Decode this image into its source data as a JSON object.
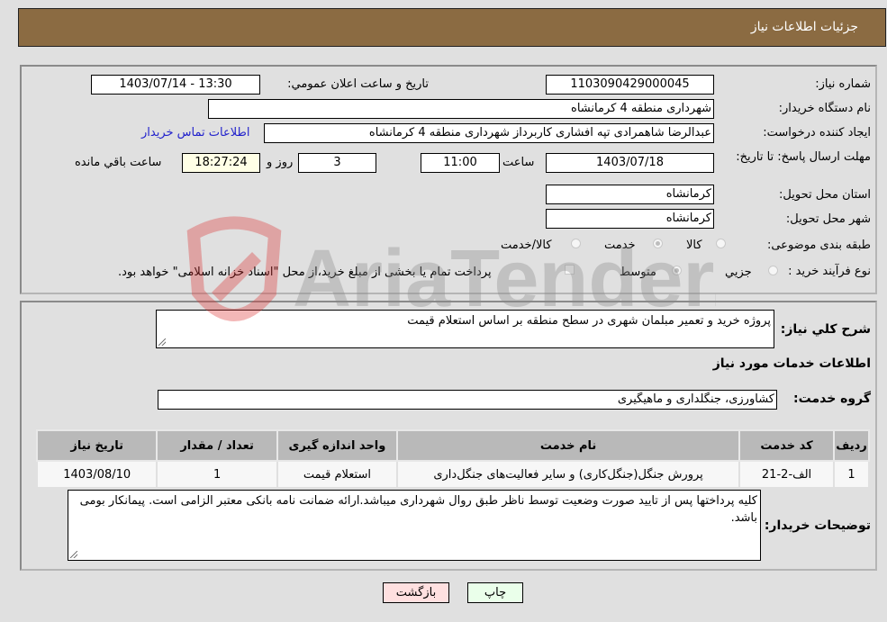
{
  "header": {
    "title": "جزئیات اطلاعات نیاز"
  },
  "form": {
    "need_number": {
      "label": "شماره نیاز:",
      "value": "1103090429000045"
    },
    "announce_datetime": {
      "label": "تاریخ و ساعت اعلان عمومي:",
      "value": "1403/07/14 - 13:30"
    },
    "buyer_org": {
      "label": "نام دستگاه خریدار:",
      "value": "شهرداری منطقه 4 کرمانشاه"
    },
    "requester": {
      "label": "ایجاد کننده درخواست:",
      "value": "عبدالرضا شاهمرادی تپه افشاری کاربرداز شهرداری منطقه 4 کرمانشاه"
    },
    "buyer_contact_link": "اطلاعات تماس خریدار",
    "deadline": {
      "label": "مهلت ارسال پاسخ: تا تاریخ:",
      "date": "1403/07/18",
      "time_label": "ساعت",
      "time": "11:00",
      "days": "3",
      "days_label": "روز و",
      "remaining": "18:27:24",
      "remaining_label": "ساعت باقي مانده"
    },
    "province": {
      "label": "استان محل تحویل:",
      "value": "کرمانشاه"
    },
    "city": {
      "label": "شهر محل تحویل:",
      "value": "کرمانشاه"
    },
    "category": {
      "label": "طبقه بندی موضوعی:",
      "options": [
        "کالا",
        "خدمت",
        "کالا/خدمت"
      ],
      "selected": "خدمت"
    },
    "purchase_type": {
      "label": "نوع فرآیند خرید :",
      "options": [
        "جزيي",
        "متوسط"
      ],
      "selected": "متوسط",
      "treasury_checkbox_label": "پرداخت تمام یا بخشی از مبلغ خرید،از محل \"اسناد خزانه اسلامی\" خواهد بود.",
      "treasury_checked": false
    }
  },
  "details": {
    "description_label": "شرح کلي نیاز:",
    "description": "پروژه خرید و تعمیر مبلمان شهری در سطح منطقه بر اساس استعلام قیمت",
    "services_heading": "اطلاعات خدمات مورد نیاز",
    "service_group_label": "گروه خدمت:",
    "service_group": "کشاورزی، جنگلداری و ماهیگیری",
    "table": {
      "headers": [
        "ردیف",
        "کد خدمت",
        "نام خدمت",
        "واحد اندازه گیری",
        "تعداد / مقدار",
        "تاریخ نیاز"
      ],
      "rows": [
        [
          "1",
          "الف-2-21",
          "پرورش جنگل(جنگل‌کاری) و سایر فعالیت‌های جنگل‌داری",
          "استعلام قیمت",
          "1",
          "1403/08/10"
        ]
      ]
    },
    "buyer_notes_label": "توضیحات خریدار:",
    "buyer_notes": "کلیه پرداختها پس از تایید صورت وضعیت توسط ناظر طبق روال شهرداری میباشد.ارائه ضمانت نامه بانکی معتبر الزامی است. پیمانکار بومی باشد."
  },
  "buttons": {
    "print": "چاپ",
    "back": "بازگشت"
  },
  "watermark": "AriaTender.neT",
  "colors": {
    "header": "#8b6b42",
    "back_button": "#ffe0e0",
    "print_button": "#eaffea",
    "link": "#2222cc"
  }
}
